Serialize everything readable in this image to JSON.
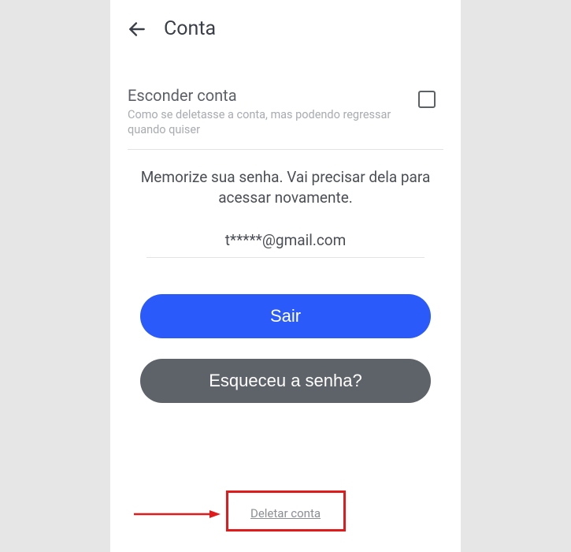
{
  "header": {
    "title": "Conta"
  },
  "hideAccount": {
    "title": "Esconder conta",
    "subtitle": "Como se deletasse a conta, mas podendo regressar quando quiser"
  },
  "memo": "Memorize sua senha. Vai precisar dela para acessar novamente.",
  "email": "t*****@gmail.com",
  "buttons": {
    "signOut": "Sair",
    "forgotPassword": "Esqueceu a senha?"
  },
  "deleteLink": "Deletar conta"
}
